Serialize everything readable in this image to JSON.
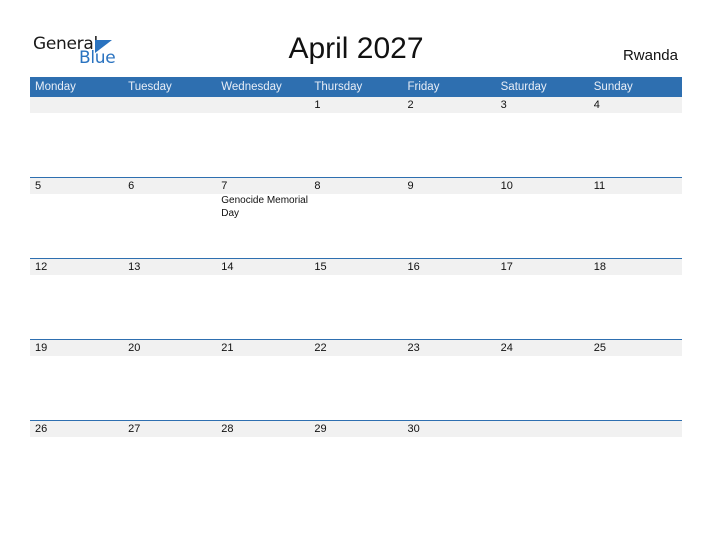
{
  "logo": {
    "text_general": "General",
    "text_blue": "Blue",
    "icon": "triangle-flag-icon",
    "brand_color": "#2a73c0"
  },
  "title": "April 2027",
  "country": "Rwanda",
  "colors": {
    "header_bg": "#2e6fb0",
    "header_text": "#e8eef7",
    "date_band": "#f1f1f1"
  },
  "weekdays": [
    "Monday",
    "Tuesday",
    "Wednesday",
    "Thursday",
    "Friday",
    "Saturday",
    "Sunday"
  ],
  "weeks": [
    {
      "days": [
        {
          "num": "",
          "event": ""
        },
        {
          "num": "",
          "event": ""
        },
        {
          "num": "",
          "event": ""
        },
        {
          "num": "1",
          "event": ""
        },
        {
          "num": "2",
          "event": ""
        },
        {
          "num": "3",
          "event": ""
        },
        {
          "num": "4",
          "event": ""
        }
      ]
    },
    {
      "days": [
        {
          "num": "5",
          "event": ""
        },
        {
          "num": "6",
          "event": ""
        },
        {
          "num": "7",
          "event": "Genocide Memorial Day"
        },
        {
          "num": "8",
          "event": ""
        },
        {
          "num": "9",
          "event": ""
        },
        {
          "num": "10",
          "event": ""
        },
        {
          "num": "11",
          "event": ""
        }
      ]
    },
    {
      "days": [
        {
          "num": "12",
          "event": ""
        },
        {
          "num": "13",
          "event": ""
        },
        {
          "num": "14",
          "event": ""
        },
        {
          "num": "15",
          "event": ""
        },
        {
          "num": "16",
          "event": ""
        },
        {
          "num": "17",
          "event": ""
        },
        {
          "num": "18",
          "event": ""
        }
      ]
    },
    {
      "days": [
        {
          "num": "19",
          "event": ""
        },
        {
          "num": "20",
          "event": ""
        },
        {
          "num": "21",
          "event": ""
        },
        {
          "num": "22",
          "event": ""
        },
        {
          "num": "23",
          "event": ""
        },
        {
          "num": "24",
          "event": ""
        },
        {
          "num": "25",
          "event": ""
        }
      ]
    },
    {
      "days": [
        {
          "num": "26",
          "event": ""
        },
        {
          "num": "27",
          "event": ""
        },
        {
          "num": "28",
          "event": ""
        },
        {
          "num": "29",
          "event": ""
        },
        {
          "num": "30",
          "event": ""
        },
        {
          "num": "",
          "event": ""
        },
        {
          "num": "",
          "event": ""
        }
      ]
    }
  ]
}
